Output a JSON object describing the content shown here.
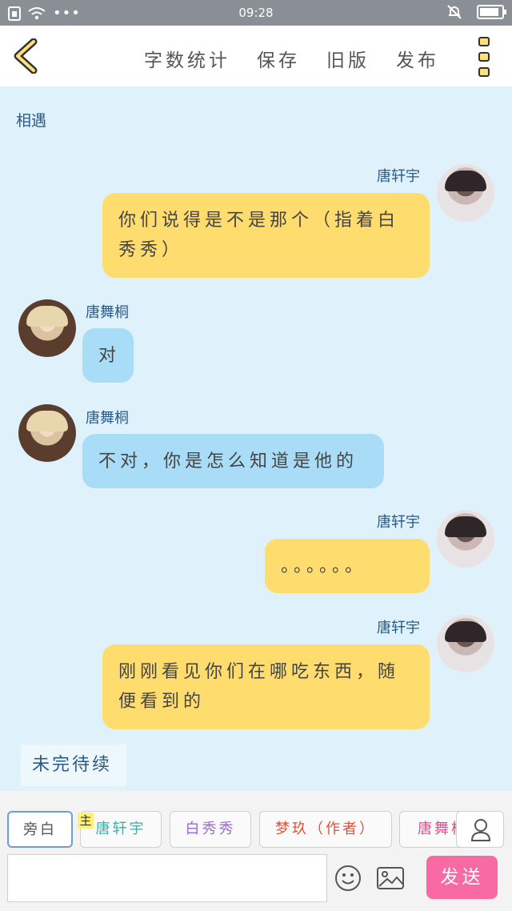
{
  "status_bar": {
    "time": "09:28",
    "battery_level": 0.9
  },
  "header": {
    "word_count": "字数统计",
    "save": "保存",
    "old_version": "旧版",
    "publish": "发布"
  },
  "chapter_title": "相遇",
  "messages": [
    {
      "speaker": "唐轩宇",
      "text": "你们说得是不是那个（指着白秀秀）"
    },
    {
      "speaker": "唐舞桐",
      "text": "对"
    },
    {
      "speaker": "唐舞桐",
      "text": "不对，你是怎么知道是他的"
    },
    {
      "speaker": "唐轩宇",
      "text": "。。。。。。"
    },
    {
      "speaker": "唐轩宇",
      "text": "刚刚看见你们在哪吃东西，随便看到的"
    }
  ],
  "narration": "未完待续",
  "roles": [
    {
      "label": "旁白",
      "color": "#555555"
    },
    {
      "label": "唐轩宇",
      "color": "#2fb5a8"
    },
    {
      "label": "白秀秀",
      "color": "#9a6ad0"
    },
    {
      "label": "梦玖（作者）",
      "color": "#e0503a"
    },
    {
      "label": "唐舞桐",
      "color": "#e0508a"
    }
  ],
  "main_tag": "主",
  "input": {
    "value": "",
    "placeholder": ""
  },
  "send_label": "发送",
  "colors": {
    "yellow_bubble": "#ffdc6e",
    "blue_bubble": "#a9dcf6",
    "send": "#f76aa3"
  },
  "icons": [
    "back-chevron-icon",
    "more-menu-icon",
    "person-icon",
    "emoji-icon",
    "image-icon"
  ]
}
